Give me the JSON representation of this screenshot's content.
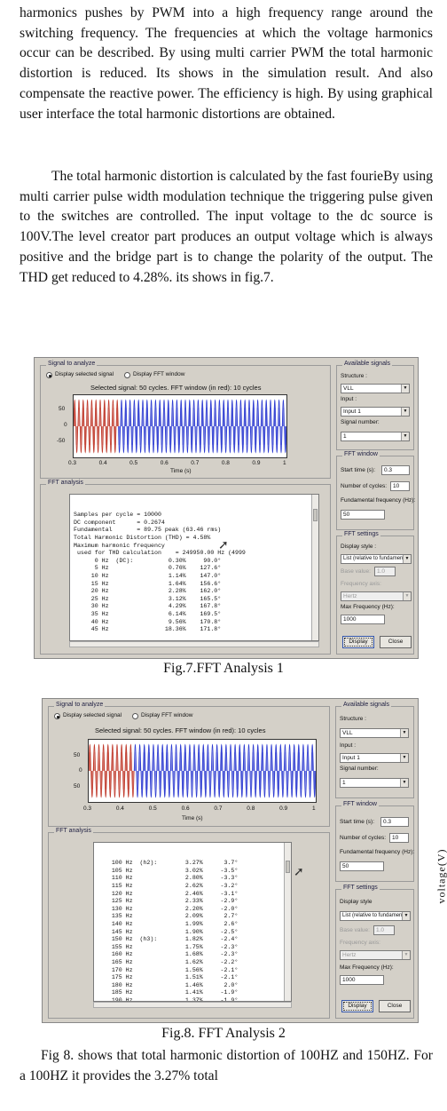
{
  "paragraph1": "harmonics pushes by PWM into a high frequency range around the switching frequency. The frequencies at which the voltage harmonics occur can be described. By using multi carrier PWM the total harmonic distortion is reduced. Its shows in the simulation result. And also compensate the reactive power. The efficiency is high. By using graphical user interface the total harmonic distortions are obtained.",
  "paragraph2": "The total harmonic distortion is calculated by the  fast fourieBy using multi carrier pulse width modulation technique the triggering pulse given to the switches are controlled. The input voltage to the dc source is 100V.The level creator part produces an output voltage which is always positive and the bridge part is to change the polarity of the output. The THD get reduced to 4.28%. its shows in fig.7.",
  "paragraph3": "Fig 8. shows that total harmonic distortion of 100HZ and 150HZ. For a 100HZ it provides the 3.27% total",
  "side_label": "voltage(V)",
  "fig1": {
    "caption": "Fig.7.FFT Analysis 1",
    "signal_group": "Signal to analyze",
    "radio_display_signal": "Display selected signal",
    "radio_display_fft": "Display FFT window",
    "plot_title": "Selected signal: 50 cycles. FFT window (in red): 10 cycles",
    "yticks": [
      "50",
      "0",
      "-50"
    ],
    "xticks": [
      "0.3",
      "0.4",
      "0.5",
      "0.6",
      "0.7",
      "0.8",
      "0.9",
      "1"
    ],
    "xlabel": "Time (s)",
    "fft_group": "FFT analysis",
    "fft_lines": [
      "Samples per cycle = 10000",
      "DC component      = 0.2674",
      "Fundamental       = 89.75 peak (63.46 rms)",
      "",
      "Total Harmonic Distortion (THD) = 4.58%",
      "",
      "Maximum harmonic frequency",
      " used for THD calculation    = 249950.00 Hz (4999",
      "",
      "      0 Hz  (DC):          0.30%     90.0°",
      "      5 Hz                 0.76%    127.6°",
      "     10 Hz                 1.14%    147.0°",
      "     15 Hz                 1.64%    156.6°",
      "     20 Hz                 2.28%    162.0°",
      "     25 Hz                 3.12%    165.5°",
      "     30 Hz                 4.29%    167.8°",
      "     35 Hz                 6.14%    169.5°",
      "     40 Hz                 9.56%    170.8°",
      "     45 Hz                18.36%    171.8°"
    ],
    "avail_group": "Available signals",
    "structure_label": "Structure :",
    "structure_value": "VLL",
    "input_label": "Input :",
    "input_value": "Input 1",
    "signal_number_label": "Signal number:",
    "signal_number_value": "1",
    "fftwin_group": "FFT window",
    "start_time_label": "Start time (s):",
    "start_time_value": "0.3",
    "cycles_label": "Number of cycles:",
    "cycles_value": "10",
    "fund_label": "Fundamental frequency (Hz):",
    "fund_value": "50",
    "settings_group": "FFT settings",
    "display_style_label": "Display style :",
    "display_style_value": "List (relative to fundamental)",
    "base_value_label": "Base value:",
    "base_value_value": "1.0",
    "freq_axis_label": "Frequency axis:",
    "freq_axis_value": "Hertz",
    "max_freq_label": "Max Frequency (Hz):",
    "max_freq_value": "1000",
    "display_button": "Display",
    "close_button": "Close"
  },
  "fig2": {
    "caption": "Fig.8. FFT Analysis 2",
    "signal_group": "Signal to analyze",
    "radio_display_signal": "Display selected signal",
    "radio_display_fft": "Display FFT window",
    "plot_title": "Selected signal: 50 cycles. FFT window (in red): 10 cycles",
    "yticks": [
      "50",
      "0",
      "50"
    ],
    "xticks": [
      "0.3",
      "0.4",
      "0.5",
      "0.6",
      "0.7",
      "0.8",
      "0.9",
      "1"
    ],
    "xlabel": "Time (s)",
    "fft_group": "FFT analysis",
    "fft_lines": [
      "    100 Hz  (h2):        3.27%      3.7°",
      "    105 Hz               3.02%     -3.5°",
      "    110 Hz               2.80%     -3.3°",
      "    115 Hz               2.62%     -3.2°",
      "    120 Hz               2.46%     -3.1°",
      "    125 Hz               2.33%     -2.9°",
      "    130 Hz               2.20%     -2.0°",
      "    135 Hz               2.09%      2.7°",
      "    140 Hz               1.99%      2.6°",
      "    145 Hz               1.90%     -2.5°",
      "    150 Hz  (h3):        1.82%     -2.4°",
      "    155 Hz               1.75%     -2.3°",
      "    160 Hz               1.68%     -2.3°",
      "    165 Hz               1.62%     -2.2°",
      "    170 Hz               1.56%     -2.1°",
      "    175 Hz               1.51%     -2.1°",
      "    180 Hz               1.46%      2.0°",
      "    185 Hz               1.41%     -1.9°",
      "    190 Hz               1.37%     -1.9°"
    ],
    "avail_group": "Available signals",
    "structure_label": "Structure :",
    "structure_value": "VLL",
    "input_label": "Input :",
    "input_value": "Input 1",
    "signal_number_label": "Signal number:",
    "signal_number_value": "1",
    "fftwin_group": "FFT window",
    "start_time_label": "Start time (s):",
    "start_time_value": "0.3",
    "cycles_label": "Number of cycles:",
    "cycles_value": "10",
    "fund_label": "Fundamental frequency (Hz):",
    "fund_value": "50",
    "settings_group": "FFT settings",
    "display_style_label": "Display style",
    "display_style_value": "List (relative to fundamental)",
    "base_value_label": "Base value:",
    "base_value_value": "1.0",
    "freq_axis_label": "Frequency axis:",
    "freq_axis_value": "Hertz",
    "max_freq_label": "Max Frequency (Hz):",
    "max_freq_value": "1000",
    "display_button": "Display",
    "close_button": "Close"
  }
}
